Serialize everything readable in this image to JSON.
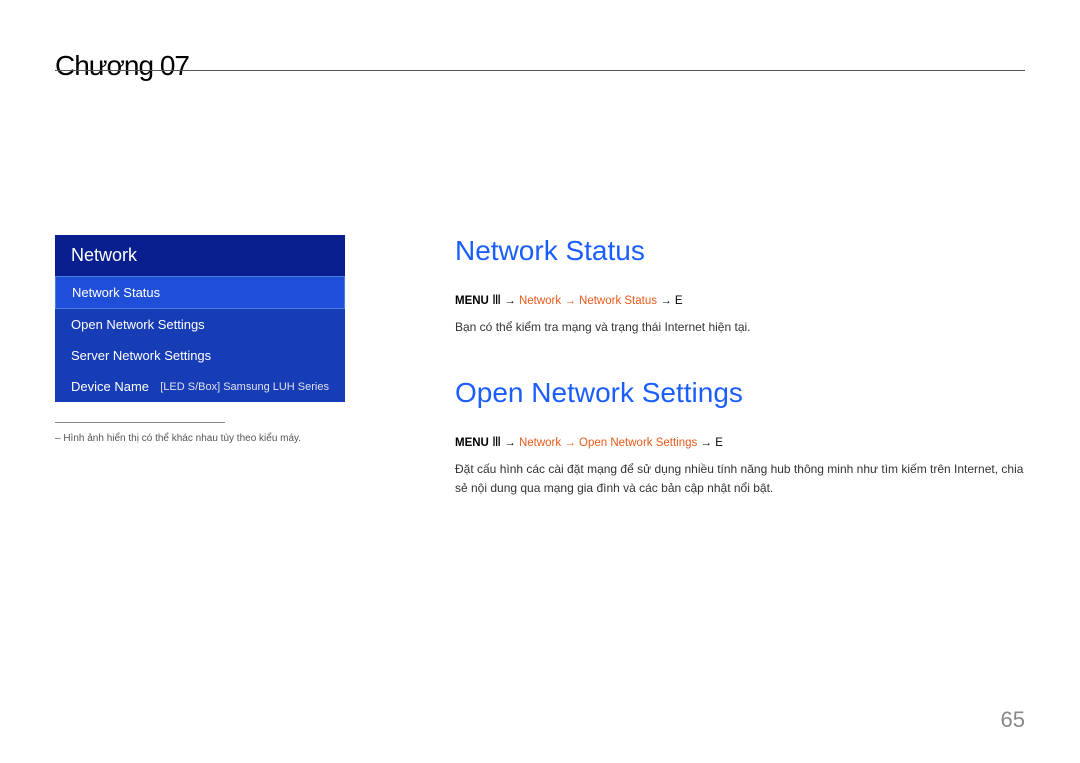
{
  "chapter": {
    "heading": "Chương 07"
  },
  "sidebar": {
    "header": "Network",
    "items": [
      {
        "label": "Network Status",
        "value": ""
      },
      {
        "label": "Open Network Settings",
        "value": ""
      },
      {
        "label": "Server Network Settings",
        "value": ""
      },
      {
        "label": "Device Name",
        "value": "[LED S/Box] Samsung LUH Series"
      }
    ],
    "footnote": "– Hình ảnh hiển thị có thể khác nhau tùy theo kiểu máy."
  },
  "content": {
    "sections": [
      {
        "title": "Network Status",
        "menu": {
          "prefix": "MENU",
          "icon": "Ⅲ",
          "arrow": "→",
          "path": "Network → Network Status",
          "enter_arrow": "→",
          "enter": "E"
        },
        "description": "Bạn có thể kiểm tra mạng và trạng thái Internet hiện tại."
      },
      {
        "title": "Open Network Settings",
        "menu": {
          "prefix": "MENU",
          "icon": "Ⅲ",
          "arrow": "→",
          "path": "Network → Open Network Settings",
          "enter_arrow": "→",
          "enter": "E"
        },
        "description": "Đặt cấu hình các cài đặt mạng để sử dụng nhiều tính năng hub thông minh như tìm kiếm trên Internet, chia sẻ nội dung qua mạng gia đình và các bản cập nhật nổi bật."
      }
    ]
  },
  "page_number": "65"
}
